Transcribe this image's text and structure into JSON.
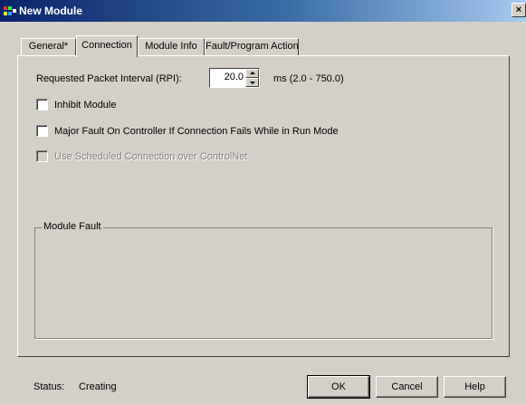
{
  "window": {
    "title": "New Module",
    "close_glyph": "×"
  },
  "tabs": [
    {
      "label": "General*",
      "active": false
    },
    {
      "label": "Connection",
      "active": true
    },
    {
      "label": "Module Info",
      "active": false
    },
    {
      "label": "Fault/Program Action",
      "active": false
    }
  ],
  "connection": {
    "rpi_label": "Requested Packet Interval (RPI):",
    "rpi_value": "20.0",
    "rpi_range": "ms (2.0 - 750.0)",
    "inhibit_label": "Inhibit Module",
    "inhibit_checked": false,
    "major_fault_label": "Major Fault On Controller If Connection Fails While in Run Mode",
    "major_fault_checked": false,
    "scheduled_label": "Use Scheduled Connection over ControlNet",
    "scheduled_checked": false,
    "scheduled_enabled": false
  },
  "module_fault": {
    "title": "Module Fault"
  },
  "status": {
    "label": "Status:",
    "value": "Creating"
  },
  "buttons": {
    "ok": "OK",
    "cancel": "Cancel",
    "help": "Help"
  },
  "icons": {
    "app": "module-app-icon",
    "close": "close-icon",
    "spin_up": "arrow-up-icon",
    "spin_down": "arrow-down-icon"
  },
  "colors": {
    "titlebar_start": "#0a246a",
    "titlebar_end": "#a6caf0",
    "face": "#d4d0c8"
  }
}
